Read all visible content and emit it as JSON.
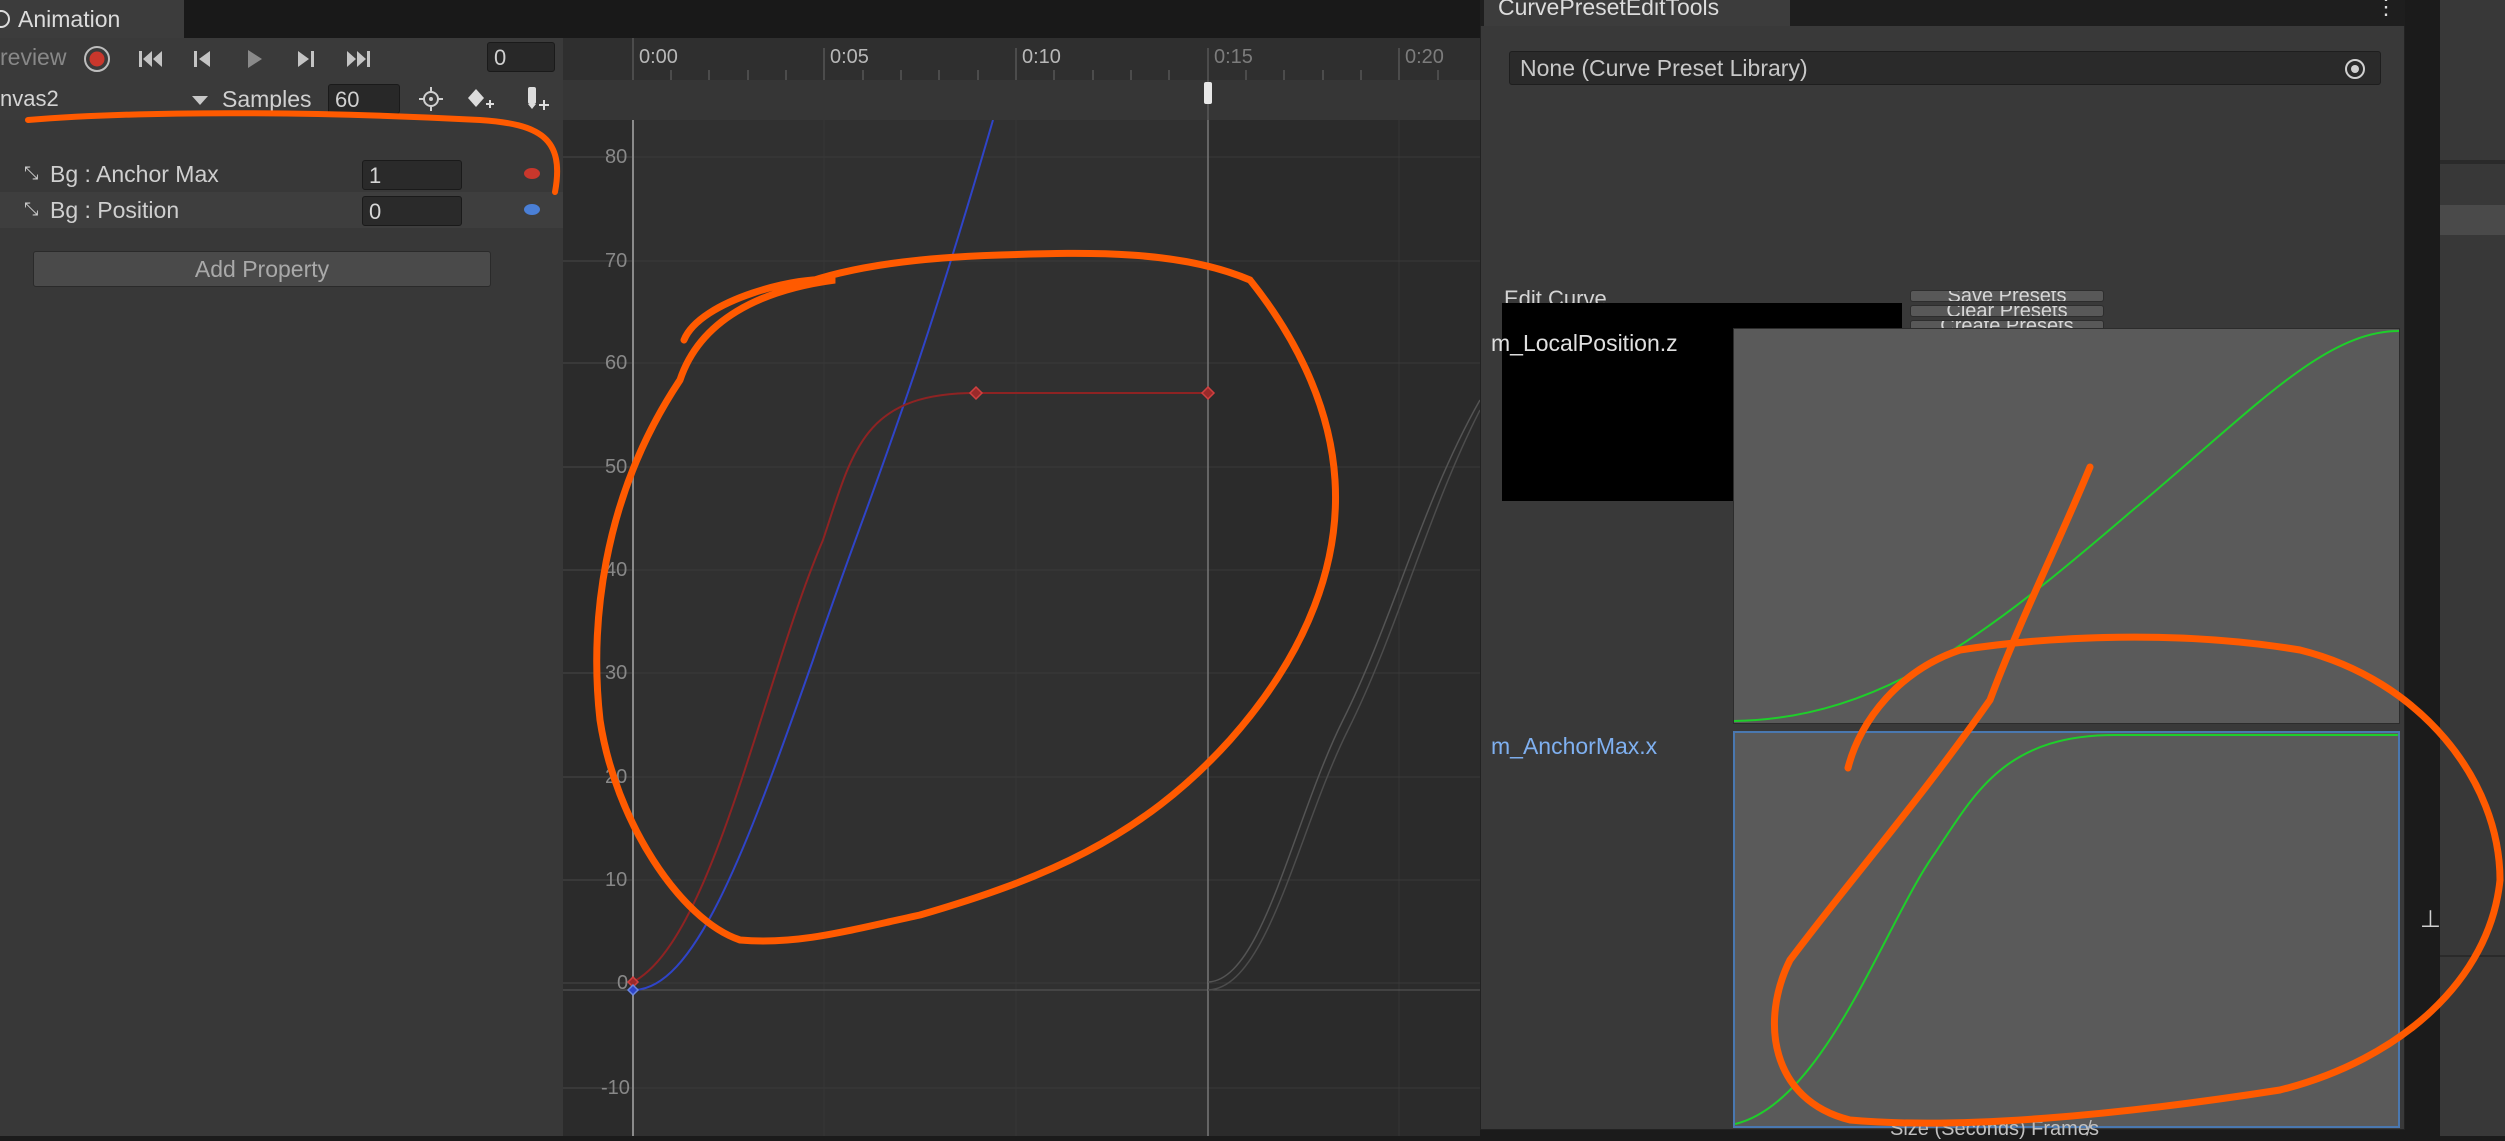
{
  "window": {
    "tab_title": "Animation"
  },
  "controls": {
    "preview_label": "review",
    "frame_value": "0",
    "clip_name": "nvas2",
    "samples_label": "Samples",
    "samples_value": "60"
  },
  "properties": [
    {
      "label": "Bg : Anchor Max",
      "value": "1",
      "dot_color": "#c9372c"
    },
    {
      "label": "Bg : Position",
      "value": "0",
      "dot_color": "#4a7fd6"
    }
  ],
  "add_property_label": "Add Property",
  "timeline": {
    "ticks": [
      "0:00",
      "0:05",
      "0:10",
      "0:15",
      "0:20"
    ],
    "y_labels": [
      "80",
      "70",
      "60",
      "50",
      "40",
      "30",
      "20",
      "10",
      "0",
      "-10"
    ]
  },
  "preset_panel": {
    "tab_title": "CurvePresetEditTools",
    "kebab": "⋮",
    "library_field": "None (Curve Preset Library)",
    "edit_curve_label": "Edit Curve",
    "buttons": [
      "Save Presets",
      "Clear Presets",
      "Create Presets"
    ],
    "curve1_title": "m_LocalPosition.z",
    "curve2_title": "m_AnchorMax.x",
    "bottom_text": "Size (Seconds) Frame̸s"
  },
  "colors": {
    "accent_red": "#c9372c",
    "accent_blue": "#4a7fd6",
    "annotation_orange": "#ff5a00",
    "curve_green": "#1ecf2a",
    "selected_title": "#7fb0f0"
  }
}
